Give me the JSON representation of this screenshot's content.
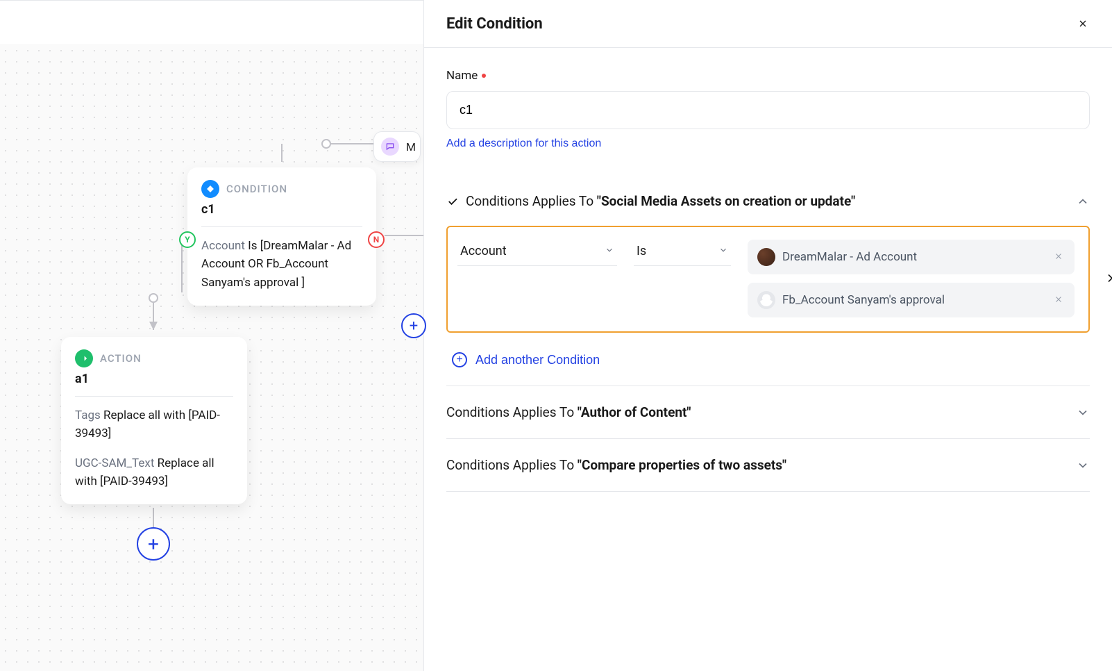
{
  "panel": {
    "title": "Edit Condition",
    "name_label": "Name",
    "name_value": "c1",
    "add_description": "Add a description for this action",
    "add_condition": "Add another Condition"
  },
  "sections": {
    "s1": {
      "prefix": "Conditions Applies To ",
      "target": "\"Social Media Assets on creation or update\"",
      "checked": true,
      "expanded": true
    },
    "s2": {
      "prefix": "Conditions Applies To ",
      "target": "\"Author of Content\"",
      "expanded": false
    },
    "s3": {
      "prefix": "Conditions Applies To ",
      "target": "\"Compare properties of two assets\"",
      "expanded": false
    }
  },
  "condition_row": {
    "field": "Account",
    "operator": "Is",
    "values": {
      "v0": "DreamMalar - Ad Account",
      "v1": "Fb_Account Sanyam's approval"
    }
  },
  "canvas": {
    "trigger_label": "M",
    "condition_node": {
      "type": "CONDITION",
      "id": "c1",
      "body_prefix": "Account",
      "body_rest": " Is [DreamMalar - Ad Account OR Fb_Account Sanyam's approval ]"
    },
    "action_node": {
      "type": "ACTION",
      "id": "a1",
      "line1_prefix": "Tags",
      "line1_rest": " Replace all with [PAID-39493]",
      "line2_prefix": "UGC-SAM_Text",
      "line2_rest": " Replace all with [PAID-39493]"
    },
    "yes": "Y",
    "no": "N"
  }
}
